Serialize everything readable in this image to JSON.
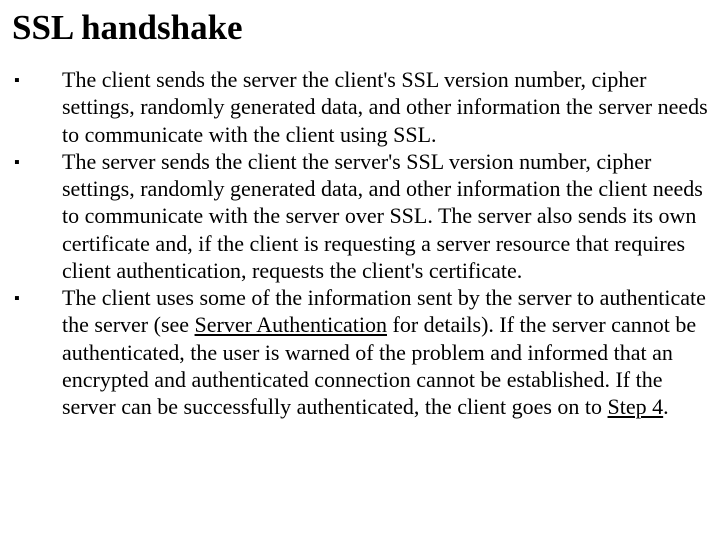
{
  "title": "SSL handshake",
  "items": [
    {
      "text": "The client sends the server the client's SSL version number, cipher settings, randomly generated data, and other information the server needs to communicate with the client using SSL."
    },
    {
      "text_before": "The server sends the client the server's SSL version number, cipher settings, randomly generated data, and other information the client needs to communicate with the server over SSL. The server also sends its own certificate and, if the client is requesting a server resource that requires client authentication, requests the client's certificate."
    },
    {
      "text_before": "The client uses some of the information sent by the server to authenticate the server (see ",
      "link1": "Server Authentication",
      "text_mid": " for details). If the server cannot be authenticated, the user is warned of the problem and informed that an encrypted and authenticated connection cannot be established. If the server can be successfully authenticated, the client goes on to ",
      "link2": "Step 4",
      "text_after": "."
    }
  ]
}
